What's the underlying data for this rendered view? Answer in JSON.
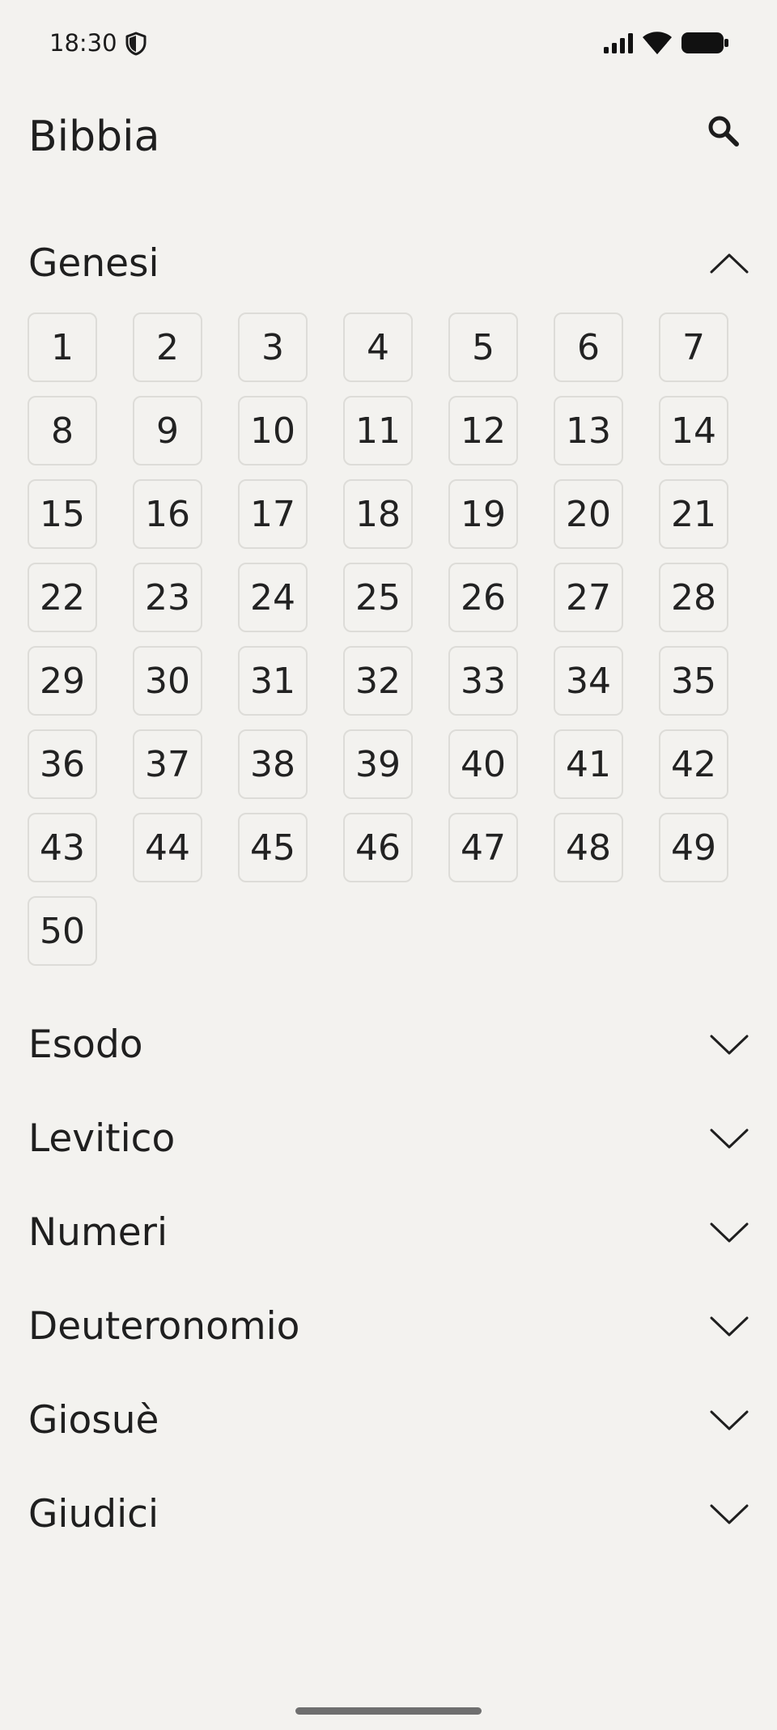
{
  "status_bar": {
    "time": "18:30",
    "icons": [
      "shield-icon",
      "signal-icon",
      "wifi-icon",
      "battery-icon"
    ]
  },
  "app_bar": {
    "title": "Bibbia",
    "search_icon": "search-icon"
  },
  "books": [
    {
      "title": "Genesi",
      "expanded": true,
      "chapter_count": 50,
      "chapters": [
        "1",
        "2",
        "3",
        "4",
        "5",
        "6",
        "7",
        "8",
        "9",
        "10",
        "11",
        "12",
        "13",
        "14",
        "15",
        "16",
        "17",
        "18",
        "19",
        "20",
        "21",
        "22",
        "23",
        "24",
        "25",
        "26",
        "27",
        "28",
        "29",
        "30",
        "31",
        "32",
        "33",
        "34",
        "35",
        "36",
        "37",
        "38",
        "39",
        "40",
        "41",
        "42",
        "43",
        "44",
        "45",
        "46",
        "47",
        "48",
        "49",
        "50"
      ]
    },
    {
      "title": "Esodo",
      "expanded": false
    },
    {
      "title": "Levitico",
      "expanded": false
    },
    {
      "title": "Numeri",
      "expanded": false
    },
    {
      "title": "Deuteronomio",
      "expanded": false
    },
    {
      "title": "Giosuè",
      "expanded": false
    },
    {
      "title": "Giudici",
      "expanded": false
    }
  ],
  "colors": {
    "background": "#f3f2ef",
    "text": "#1f1f1f",
    "cell_border": "#dddcd8"
  }
}
